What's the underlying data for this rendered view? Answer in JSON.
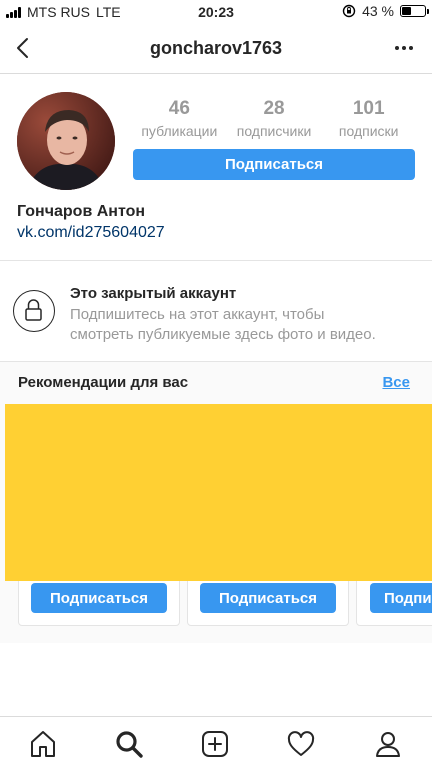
{
  "status_bar": {
    "carrier": "MTS RUS",
    "network": "LTE",
    "time": "20:23",
    "battery_percent": "43 %",
    "battery_level": 0.43
  },
  "nav": {
    "title": "goncharov1763",
    "back_icon": "chevron-left-icon",
    "more_icon": "more-dots-icon"
  },
  "profile": {
    "stats": [
      {
        "value": "46",
        "label": "публикации"
      },
      {
        "value": "28",
        "label": "подписчики"
      },
      {
        "value": "101",
        "label": "подписки"
      }
    ],
    "follow_label": "Подписаться",
    "name": "Гончаров Антон",
    "link": "vk.com/id275604027"
  },
  "private": {
    "icon": "lock-icon",
    "title": "Это закрытый аккаунт",
    "line1": "Подпишитесь на этот аккаунт, чтобы",
    "line2": "смотреть публикуемые здесь фото и видео."
  },
  "recommendations": {
    "title": "Рекомендации для вас",
    "all_label": "Все",
    "follow_labels": [
      "Подписаться",
      "Подписаться",
      "Подпи"
    ]
  },
  "tab_bar": {
    "icons": [
      "home-icon",
      "search-icon",
      "new-post-icon",
      "heart-icon",
      "profile-icon"
    ]
  },
  "colors": {
    "accent": "#3897f0",
    "overlay": "#ffd033",
    "muted": "#999999"
  }
}
